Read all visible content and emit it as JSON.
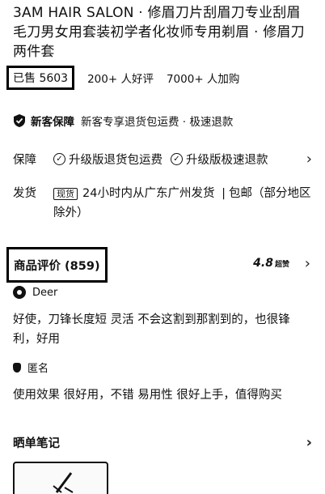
{
  "product": {
    "title": "3AM HAIR SALON · 修眉刀片刮眉刀专业刮眉毛刀男女用套装初学者化妆师专用剃眉 · 修眉刀两件套"
  },
  "stats": {
    "sold": "已售 5603",
    "good_reviews": "200+ 人好评",
    "added": "7000+ 人加购"
  },
  "new_guarantee": {
    "label": "新客保障",
    "text": "新客专享退货包运费 · 极速退款"
  },
  "protection": {
    "label": "保障",
    "items": [
      "升级版退货包运费",
      "升级版极速退款"
    ]
  },
  "shipping": {
    "label": "发货",
    "tag": "现货",
    "text": "24小时内从广东广州发货",
    "sep": "|",
    "extra": "包邮（部分地区除外）"
  },
  "reviews": {
    "title": "商品评价 (859)",
    "score": "4.8",
    "score_label": "超赞",
    "items": [
      {
        "user": "Deer",
        "text": "好使，刀锋长度短 灵活 不会这割到那割到的，也很锋利，好用"
      },
      {
        "user": "匿名",
        "text": "使用效果 很好用，不错 易用性 很好上手，值得购买"
      }
    ]
  },
  "notes": {
    "title": "晒单笔记"
  },
  "icons": {
    "shield": "shield-check-icon",
    "check": "check-circle-icon",
    "chevron": "chevron-right-icon"
  }
}
